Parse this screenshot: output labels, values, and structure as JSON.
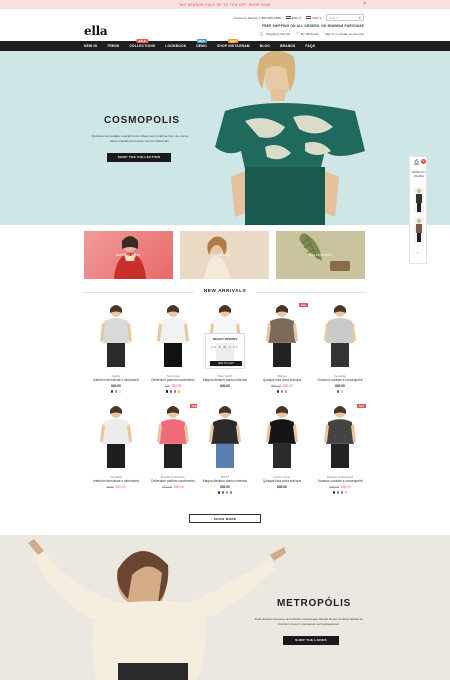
{
  "promo": {
    "text": "Big season sale up to 70% off. Shop now"
  },
  "header": {
    "logo": "ella",
    "customer_service": "Customer Service 1-800-555-5588",
    "currency": "USD",
    "language": "ENG",
    "search_placeholder": "Search",
    "free_shipping": "FREE SHIPPING ON ALL ORDERS. NO MINIMUM PURCHASE",
    "cart_label": "Shopping Cart",
    "cart_count": "0",
    "wishlist_label": "My Wish lists",
    "account_label": "Sign in or Create an account"
  },
  "nav": {
    "items": [
      {
        "label": "New In",
        "badge": ""
      },
      {
        "label": "Trend",
        "badge": ""
      },
      {
        "label": "Collections",
        "badge": "Sale",
        "badge_color": "#e05b5b"
      },
      {
        "label": "Lookbook",
        "badge": ""
      },
      {
        "label": "Demo",
        "badge": "New",
        "badge_color": "#3aa4d8"
      },
      {
        "label": "Shop Instagram",
        "badge": "Hot",
        "badge_color": "#f0a030"
      },
      {
        "label": "Blog",
        "badge": ""
      },
      {
        "label": "Brands",
        "badge": ""
      },
      {
        "label": "FAQs",
        "badge": ""
      }
    ]
  },
  "hero": {
    "title": "COSMOPOLIS",
    "text": "Quisquemos sodales suscipit tortor ditaemcos condimentum de cosmo lacus meleifend menean viverra sollicitudin.",
    "button": "SHOP THE COLLECTION"
  },
  "side_widget": {
    "count": "0",
    "label": "RECENTLY VIEWED"
  },
  "categories": [
    {
      "label": "fashion style"
    },
    {
      "label": "beauty"
    },
    {
      "label": "accessories"
    }
  ],
  "new_arrivals": {
    "title": "NEW ARRIVALS",
    "quickview": {
      "title": "SELECT OPTIONS",
      "sizes": "XS S M L XL",
      "button": "ADD TO CART"
    },
    "products": [
      {
        "vendor": "Gabby",
        "name": "Interdum demulnae e dionduerts",
        "price_old": "",
        "price": "$30.00",
        "sale": false,
        "swatches": [
          "#333333",
          "#999999",
          "#dddddd"
        ]
      },
      {
        "vendor": "Tomorrow",
        "name": "Deiterdum partium condimento",
        "price_old": "$40",
        "price": "$39.55",
        "sale": false,
        "swatches": [
          "#111111",
          "#3c6fd0",
          "#e05b5b",
          "#f0c040"
        ]
      },
      {
        "vendor": "Paul Smith",
        "name": "Magna dientum mano nortendo",
        "price_old": "",
        "price": "$30.00",
        "sale": false,
        "swatches": []
      },
      {
        "vendor": "Mango",
        "name": "Quisque lisia mota ironique",
        "price_old": "$66.00",
        "price": "$59.00",
        "sale": true,
        "swatches": [
          "#333333",
          "#8a8a8a",
          "#c7a27a"
        ]
      },
      {
        "vendor": "Vendetta",
        "name": "Vivamus vulutate a consequehit",
        "price_old": "",
        "price": "$30.00",
        "sale": false,
        "swatches": [
          "#666666",
          "#cccccc"
        ]
      },
      {
        "vendor": "Vendetta",
        "name": "Interdum demulnae e dionduerts",
        "price_old": "From",
        "price": "$30.00",
        "sale": false,
        "swatches": []
      },
      {
        "vendor": "Everlil Connection",
        "name": "Deiterdum partium condimento",
        "price_old": "$50.00",
        "price": "$30.00",
        "sale": true,
        "swatches": []
      },
      {
        "vendor": "MXTT",
        "name": "Magna dientum mano nortendo",
        "price_old": "",
        "price": "$30.00",
        "sale": false,
        "swatches": [
          "#333333",
          "#3c6fd0",
          "#999999",
          "#e05b5b"
        ]
      },
      {
        "vendor": "Jimmy Choo",
        "name": "Quisque lisia mota ironique",
        "price_old": "",
        "price": "$30.00",
        "sale": false,
        "swatches": []
      },
      {
        "vendor": "Modern Kinuswood",
        "name": "Vivamus vulutate a consequehit",
        "price_old": "$40.00",
        "price": "$30.00",
        "sale": true,
        "swatches": [
          "#333333",
          "#8a8a8a",
          "#e05b5b",
          "#cccccc"
        ]
      }
    ],
    "show_more": "SHOW MORE"
  },
  "banner2": {
    "title": "METROPÓLIS",
    "text": "Pellentesque posuere orci lobortis scelerisque blandit Donec id tellus lacinia an tincidunt risus in consequat sed quisquamos.",
    "button": "SHOP THE LOOKS"
  }
}
